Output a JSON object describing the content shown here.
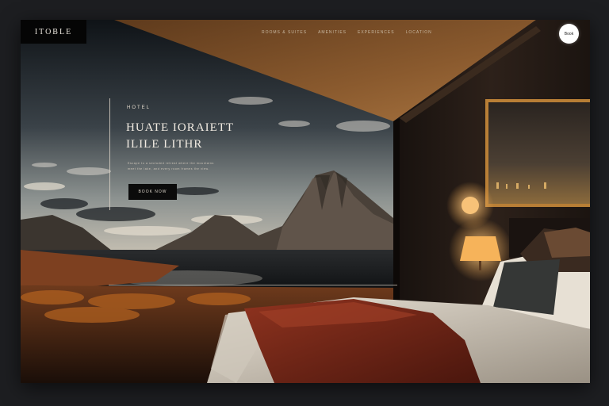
{
  "brand": {
    "logo_text": "ITOBLE"
  },
  "nav": {
    "links": [
      "ROOMS & SUITES",
      "AMENITIES",
      "EXPERIENCES",
      "LOCATION"
    ],
    "cta_label": "Book"
  },
  "hero": {
    "eyebrow": "HOTEL",
    "headline_lines": [
      "HUATE IORAIETT",
      "ILILE LITHR"
    ],
    "copy_lines": [
      "Escape to a secluded retreat where the mountains",
      "meet the lake, and every room frames the view."
    ],
    "cta_label": "BOOK NOW"
  },
  "colors": {
    "page_bg": "#1d1e21",
    "ceiling": "#7a4f28",
    "accent_glow": "#f2b45a",
    "throw": "#7c2a1c",
    "button_dark": "#0b0b0b"
  },
  "icons": {
    "scene": "hotel-room-landscape-image"
  }
}
